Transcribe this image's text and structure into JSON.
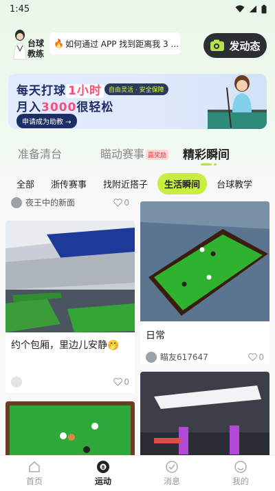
{
  "status": {
    "time": "1:45"
  },
  "header": {
    "coach_label": "台球\n教练",
    "ask_text": "如何通过 APP 找到距离我 3 ...",
    "post_button": "发动态"
  },
  "banner": {
    "line1_prefix": "每天打球",
    "line1_hl": "1小时",
    "tag": "自由灵活 · 安全保障",
    "line2_prefix": "月入",
    "line2_hl": "3000",
    "line2_suffix": "很轻松",
    "cta": "申请成为助教 →"
  },
  "main_tabs": [
    {
      "label": "准备清台"
    },
    {
      "label": "瞄动赛事",
      "badge": "赢奖励"
    },
    {
      "label": "精彩瞬间"
    }
  ],
  "sub_tabs": [
    "全部",
    "浙传赛事",
    "找附近搭子",
    "生活瞬间",
    "台球教学"
  ],
  "feed": {
    "partial_top_user": "夜王中的新面",
    "partial_top_likes": "0",
    "cards": [
      {
        "title": "约个包厢，里边儿安静🤭",
        "user": "",
        "likes": "0"
      },
      {
        "title": "日常",
        "user": "瞄友617647",
        "likes": "0"
      }
    ]
  },
  "nav": [
    {
      "label": "首页",
      "icon": "home-icon"
    },
    {
      "label": "运动",
      "icon": "billiard-ball-icon"
    },
    {
      "label": "消息",
      "icon": "message-icon"
    },
    {
      "label": "我的",
      "icon": "profile-icon"
    }
  ],
  "colors": {
    "accent": "#c8ef3f",
    "dark_button": "#2b2f33"
  }
}
